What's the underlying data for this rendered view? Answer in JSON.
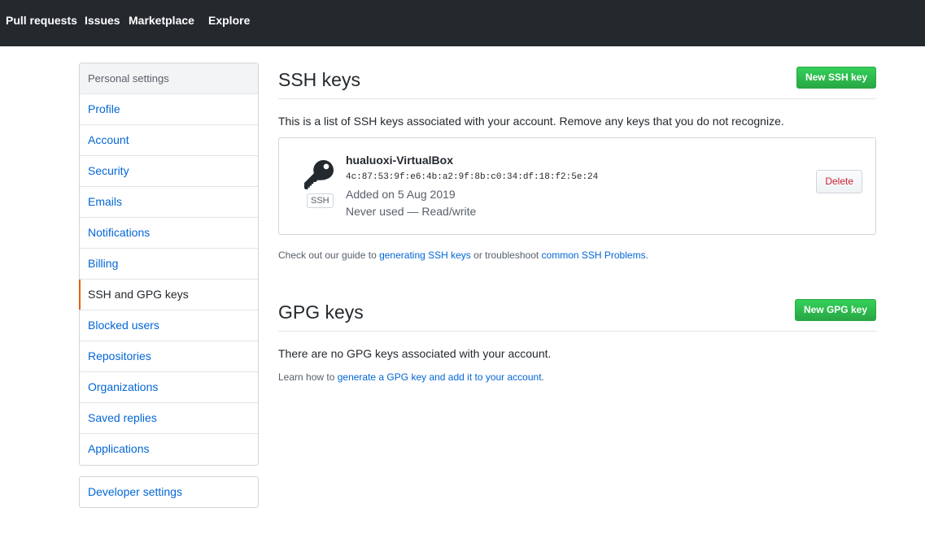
{
  "nav": {
    "items": [
      "Pull requests",
      "Issues",
      "Marketplace",
      "Explore"
    ]
  },
  "sidebar": {
    "header": "Personal settings",
    "items": [
      {
        "label": "Profile"
      },
      {
        "label": "Account"
      },
      {
        "label": "Security"
      },
      {
        "label": "Emails"
      },
      {
        "label": "Notifications"
      },
      {
        "label": "Billing"
      },
      {
        "label": "SSH and GPG keys",
        "selected": true
      },
      {
        "label": "Blocked users"
      },
      {
        "label": "Repositories"
      },
      {
        "label": "Organizations"
      },
      {
        "label": "Saved replies"
      },
      {
        "label": "Applications"
      }
    ],
    "developer": "Developer settings"
  },
  "ssh": {
    "title": "SSH keys",
    "new_button": "New SSH key",
    "description": "This is a list of SSH keys associated with your account. Remove any keys that you do not recognize.",
    "key": {
      "badge": "SSH",
      "title": "hualuoxi-VirtualBox",
      "fingerprint": "4c:87:53:9f:e6:4b:a2:9f:8b:c0:34:df:18:f2:5e:24",
      "added": "Added on 5 Aug 2019",
      "usage": "Never used — Read/write",
      "delete_label": "Delete"
    },
    "guide": {
      "prefix": "Check out our guide to ",
      "link1": "generating SSH keys",
      "middle": " or troubleshoot ",
      "link2": "common SSH Problems",
      "suffix": "."
    }
  },
  "gpg": {
    "title": "GPG keys",
    "new_button": "New GPG key",
    "empty": "There are no GPG keys associated with your account.",
    "help": {
      "prefix": "Learn how to ",
      "link": "generate a GPG key and add it to your account",
      "suffix": "."
    }
  },
  "colors": {
    "nav_bg": "#24292e",
    "link": "#0366d6",
    "accent_selected": "#e36209",
    "green_button": "#2ea44f",
    "danger": "#cb2431"
  },
  "icons": {
    "ssh_key": "key-icon"
  }
}
